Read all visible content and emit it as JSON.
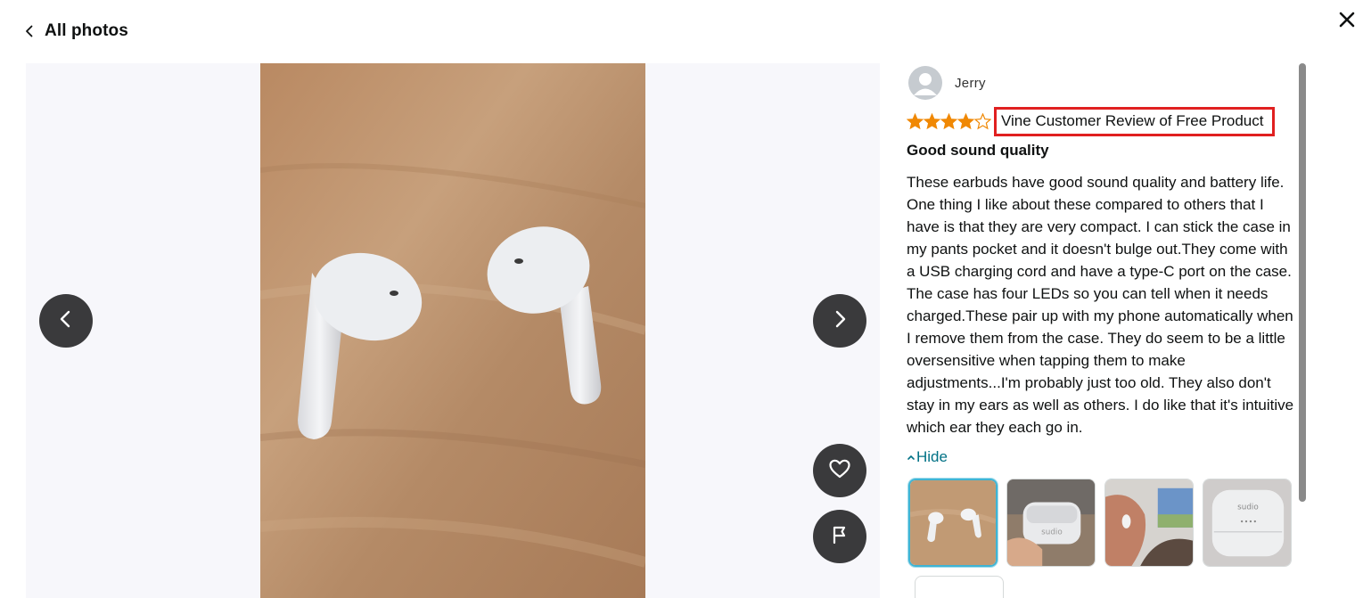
{
  "header": {
    "back_label": "All photos",
    "back_icon": "chevron-left-icon",
    "close_icon": "close-icon"
  },
  "viewer": {
    "prev_icon": "chevron-left-icon",
    "next_icon": "chevron-right-icon",
    "like_icon": "heart-icon",
    "report_icon": "flag-icon"
  },
  "review": {
    "reviewer_name": "Jerry",
    "rating": 4,
    "rating_max": 5,
    "star_color": "#f08804",
    "vine_label": "Vine Customer Review of Free Product",
    "title": "Good sound quality",
    "body": "These earbuds have good sound quality and battery life. One thing I like about these compared to others that I have is that they are very compact. I can stick the case in my pants pocket and it doesn't bulge out.They come with a USB charging cord and have a type-C port on the case. The case has four LEDs so you can tell when it needs charged.These pair up with my phone automatically when I remove them from the case. They do seem to be a little oversensitive when tapping them to make adjustments...I'm probably just too old. They also don't stay in my ears as well as others. I do like that it's intuitive which ear they each go in.",
    "hide_label": "Hide",
    "hide_icon": "caret-up-icon",
    "link_color": "#007185",
    "highlight_color": "#e02020"
  },
  "thumbnails": [
    {
      "name": "earbuds-on-table",
      "selected": true
    },
    {
      "name": "case-in-hand",
      "selected": false
    },
    {
      "name": "earbud-in-ear",
      "selected": false
    },
    {
      "name": "closed-case",
      "selected": false
    }
  ]
}
